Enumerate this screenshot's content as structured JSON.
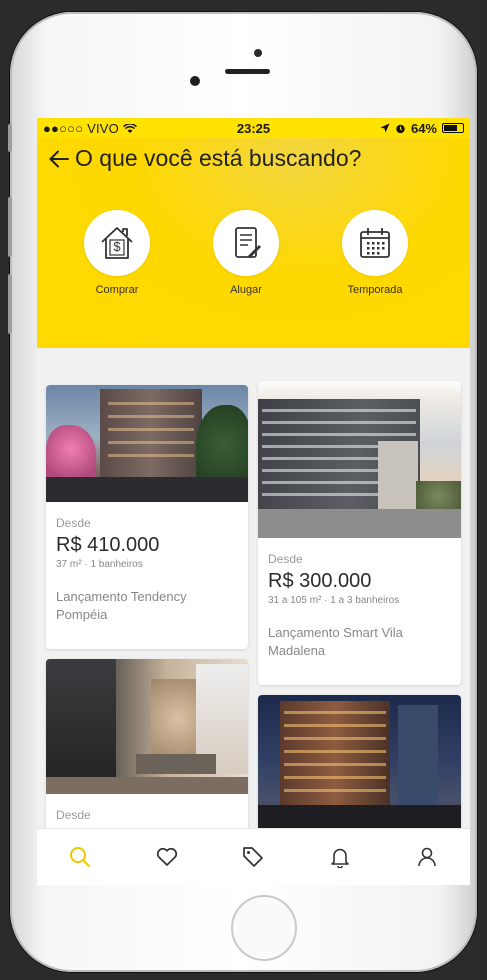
{
  "status_bar": {
    "carrier": "●●○○○ VIVO",
    "time": "23:25",
    "battery": "64%"
  },
  "header": {
    "back_icon": "arrow-left-icon",
    "title": "O que você está buscando?"
  },
  "categories": [
    {
      "label": "Comprar",
      "icon": "house-dollar-icon"
    },
    {
      "label": "Alugar",
      "icon": "contract-icon"
    },
    {
      "label": "Temporada",
      "icon": "calendar-icon"
    }
  ],
  "listings": [
    {
      "desde": "Desde",
      "price": "R$ 410.000",
      "area": "37 m²",
      "details": " · 1 banheiros",
      "name": "Lançamento Tendency Pompéia"
    },
    {
      "desde": "Desde",
      "price": "R$ 300.000",
      "area": "31 a 105 m²",
      "details": " · 1 a 3 banheiros",
      "name": "Lançamento Smart Vila Madalena"
    },
    {
      "desde": "Desde"
    },
    {}
  ],
  "tabbar": {
    "items": [
      {
        "icon": "search-icon",
        "active": true
      },
      {
        "icon": "heart-icon"
      },
      {
        "icon": "tag-icon"
      },
      {
        "icon": "bell-icon"
      },
      {
        "icon": "user-icon"
      }
    ]
  },
  "colors": {
    "accent": "#FFDD00",
    "active_tab": "#F2C500"
  }
}
